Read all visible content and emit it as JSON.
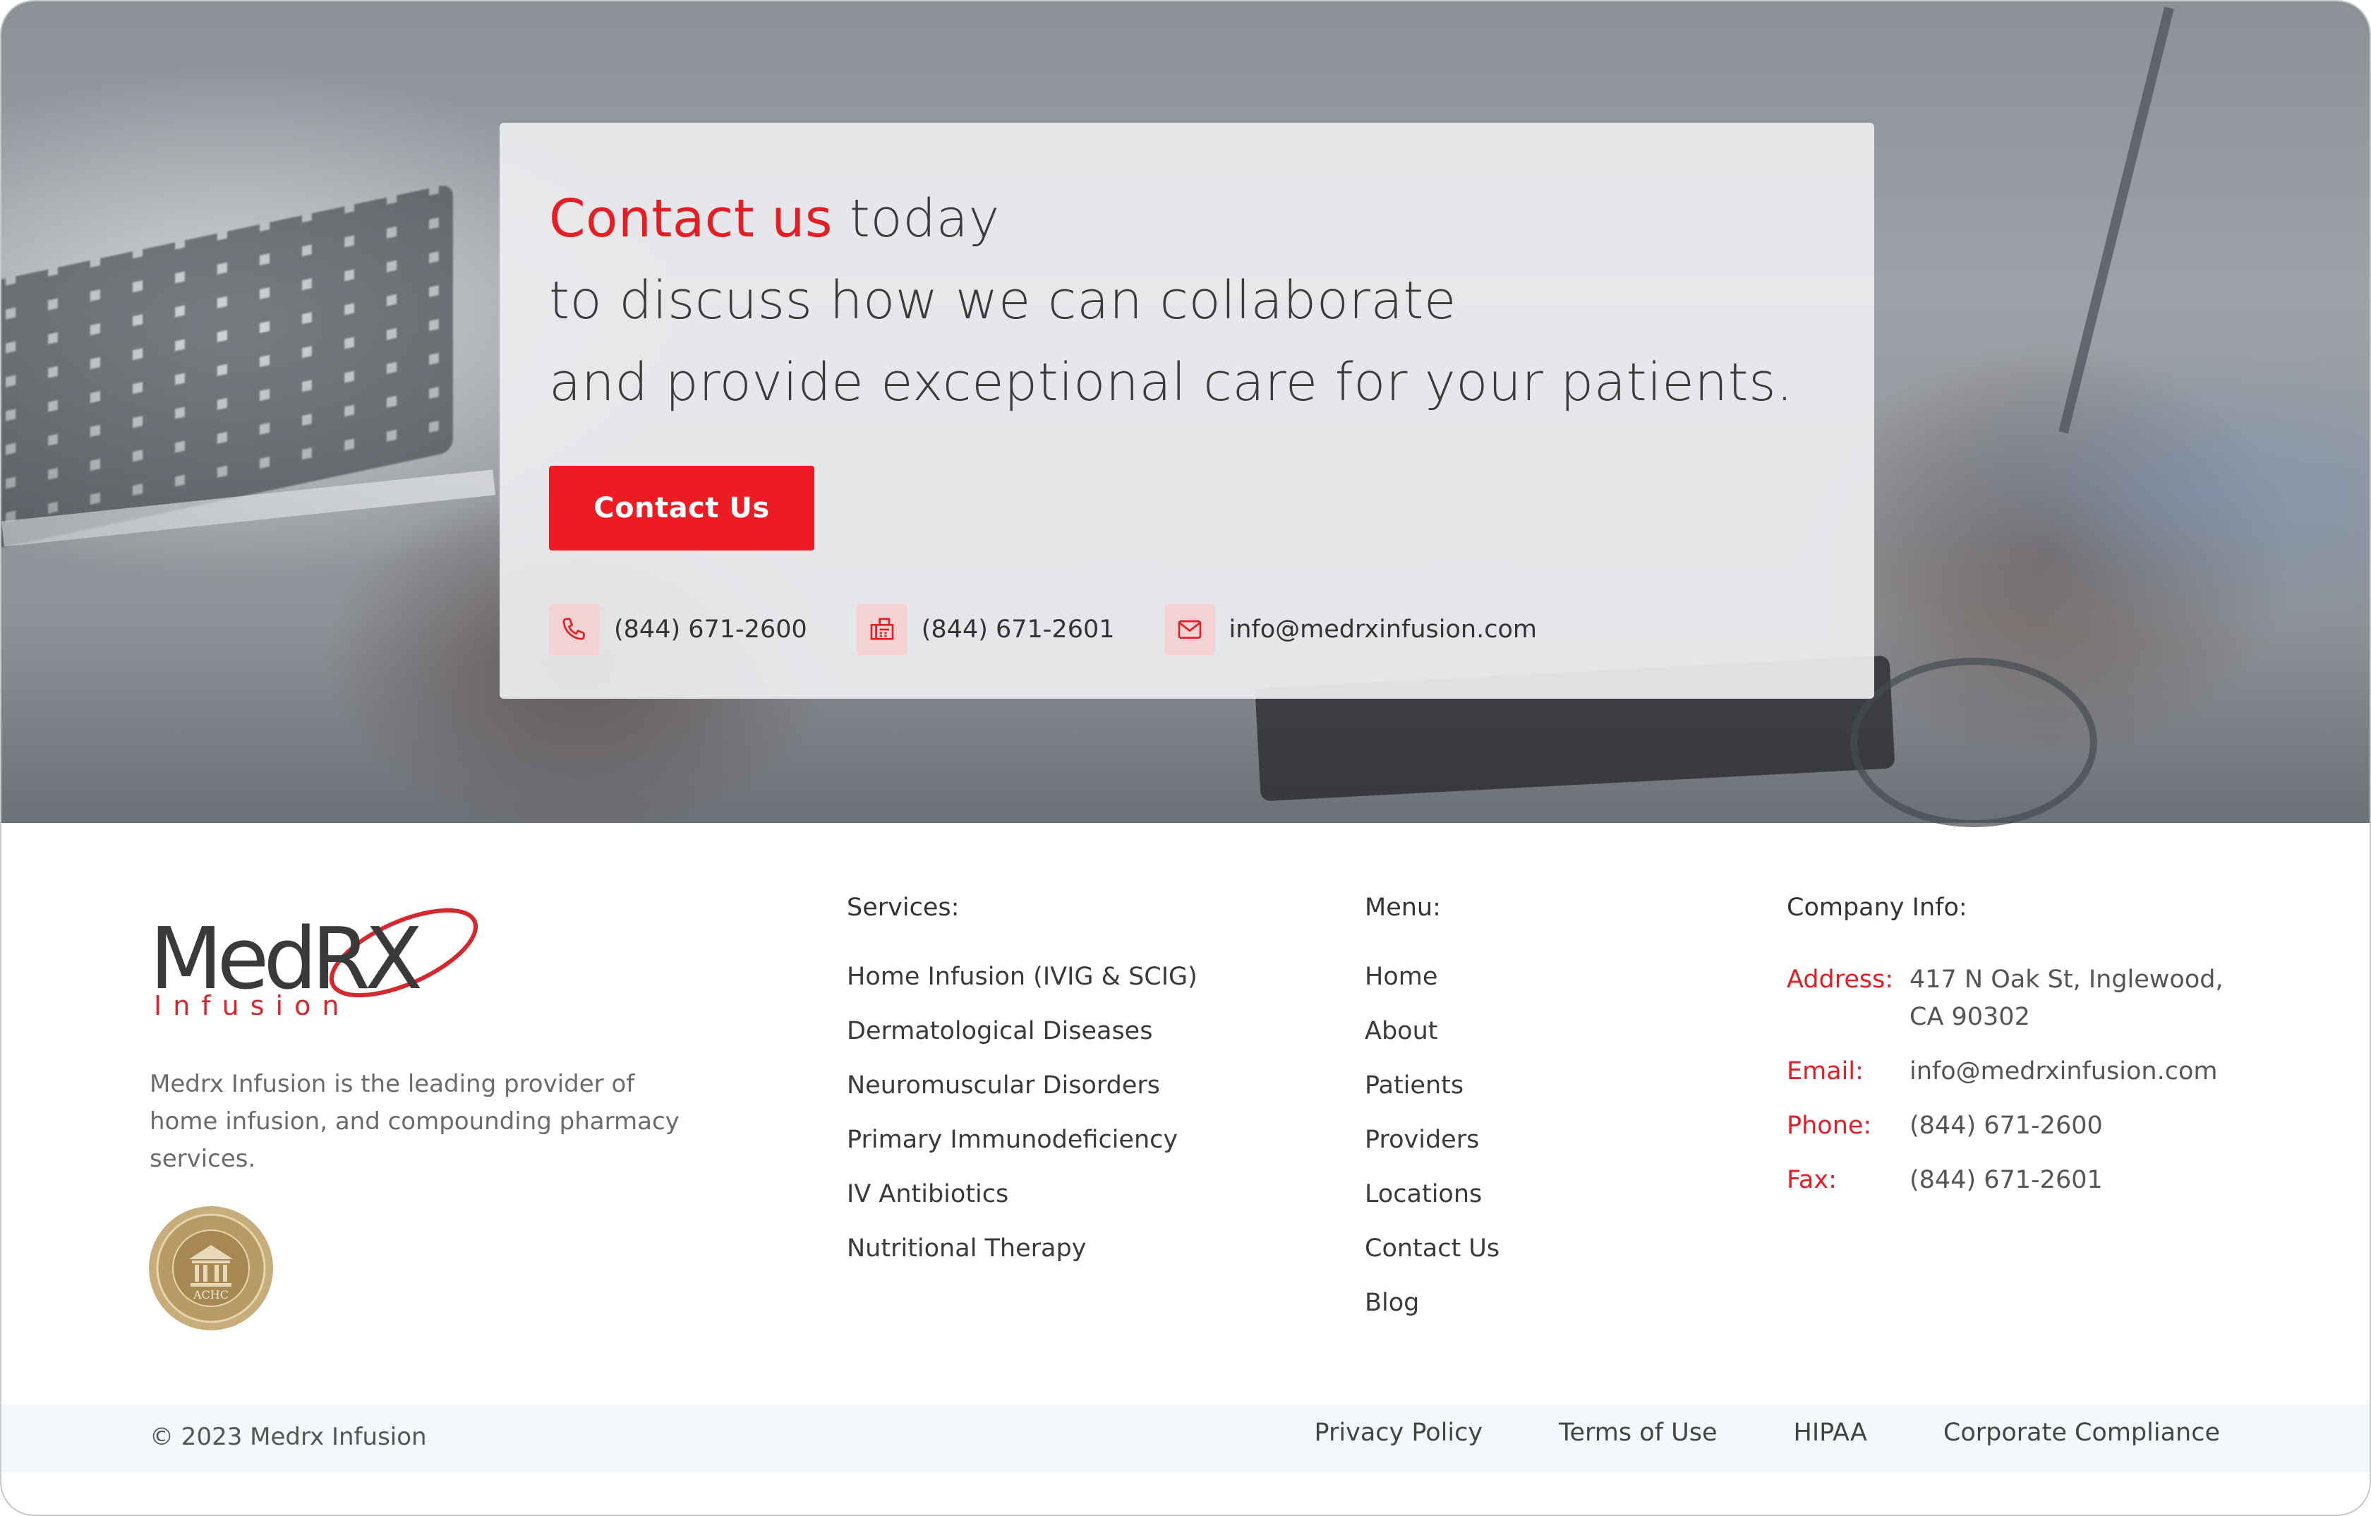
{
  "hero": {
    "headline_accent": "Contact us",
    "headline_rest": " today",
    "headline_line2": "to discuss how we can collaborate",
    "headline_line3": "and provide exceptional care for your patients.",
    "cta_label": "Contact Us",
    "contacts": [
      {
        "icon": "phone-icon",
        "text": "(844) 671-2600"
      },
      {
        "icon": "fax-icon",
        "text": "(844) 671-2601"
      },
      {
        "icon": "email-icon",
        "text": "info@medrxinfusion.com"
      }
    ]
  },
  "footer": {
    "logo_text": "MedRX",
    "logo_sub": "Infusion",
    "about": "Medrx Infusion is the leading provider of home infusion, and compounding pharmacy services.",
    "seal_text": "ACHC",
    "services": {
      "title": "Services:",
      "items": [
        "Home Infusion (IVIG & SCIG)",
        "Dermatological Diseases",
        "Neuromuscular Disorders",
        "Primary Immunodeficiency",
        "IV Antibiotics",
        "Nutritional Therapy"
      ]
    },
    "menu": {
      "title": "Menu:",
      "items": [
        "Home",
        "About",
        "Patients",
        "Providers",
        "Locations",
        "Contact Us",
        "Blog"
      ]
    },
    "company": {
      "title": "Company Info:",
      "address_label": "Address:",
      "address_line1": "417 N Oak St, Inglewood,",
      "address_line2": "CA 90302",
      "email_label": "Email:",
      "email": "info@medrxinfusion.com",
      "phone_label": "Phone:",
      "phone": "(844) 671-2600",
      "fax_label": "Fax:",
      "fax": "(844) 671-2601"
    },
    "copyright": "© 2023 Medrx Infusion",
    "legal_links": [
      "Privacy Policy",
      "Terms of Use",
      "HIPAA",
      "Corporate Compliance"
    ]
  },
  "colors": {
    "accent": "#ed1c24",
    "icon_bg": "#f3d3d4",
    "bottom_bar": "#f3f9fb"
  }
}
